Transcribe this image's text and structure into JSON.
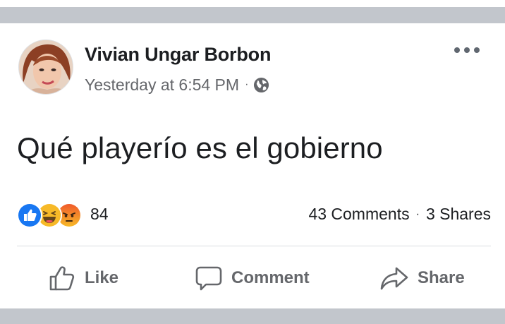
{
  "post": {
    "author_name": "Vivian Ungar Borbon",
    "timestamp": "Yesterday at 6:54 PM",
    "meta_separator": "·",
    "audience_icon": "globe-icon",
    "body_text": "Qué playerío es el gobierno",
    "more_icon": "more-dots-icon"
  },
  "engagement": {
    "reaction_types": [
      "like",
      "haha",
      "angry"
    ],
    "reaction_count": "84",
    "comments": "43 Comments",
    "separator": "·",
    "shares": "3 Shares"
  },
  "actions": {
    "like_label": "Like",
    "comment_label": "Comment",
    "share_label": "Share"
  },
  "colors": {
    "text_primary": "#1c1e21",
    "text_secondary": "#65676b",
    "like_blue": "#1877f2",
    "haha_yellow": "#f7b928",
    "angry_orange": "#e9710f",
    "band_gray": "#c2c6cc"
  }
}
